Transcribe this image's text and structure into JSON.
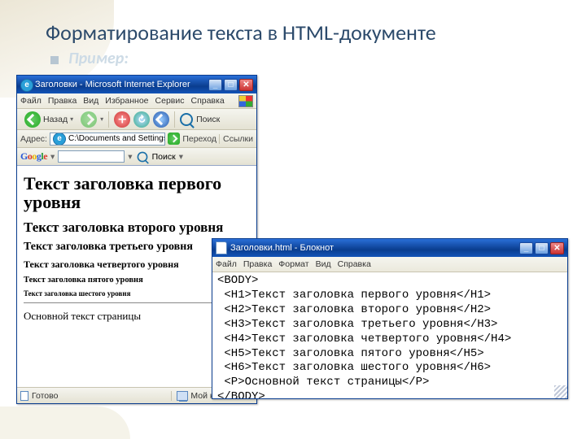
{
  "slide": {
    "title": "Форматирование текста в HTML-документе",
    "subtitle": "Пример:"
  },
  "ie": {
    "title": "Заголовки - Microsoft Internet Explorer",
    "menu": [
      "Файл",
      "Правка",
      "Вид",
      "Избранное",
      "Сервис",
      "Справка"
    ],
    "back_label": "Назад",
    "search_label": "Поиск",
    "addr_label": "Адрес:",
    "addr_value": "C:\\Documents and Settings\\Мари",
    "go_label": "Переход",
    "links_label": "Ссылки",
    "google_search": "Поиск",
    "headings": {
      "h1": "Текст заголовка первого уровня",
      "h2": "Текст заголовка второго уровня",
      "h3": "Текст заголовка третьего уровня",
      "h4": "Текст заголовка четвертого уровня",
      "h5": "Текст заголовка пятого уровня",
      "h6": "Текст заголовка шестого уровня",
      "p": "Основной текст страницы"
    },
    "status_done": "Готово",
    "status_zone": "Мой компьюте"
  },
  "notepad": {
    "title": "Заголовки.html - Блокнот",
    "menu": [
      "Файл",
      "Правка",
      "Формат",
      "Вид",
      "Справка"
    ],
    "lines": [
      "<BODY>",
      " <H1>Текст заголовка первого уровня</H1>",
      " <H2>Текст заголовка второго уровня</H2>",
      " <H3>Текст заголовка третьего уровня</H3>",
      " <H4>Текст заголовка четвертого уровня</H4>",
      " <H5>Текст заголовка пятого уровня</H5>",
      " <H6>Текст заголовка шестого уровня</H6>",
      " <P>Основной текст страницы</P>",
      "</BODY>"
    ]
  }
}
